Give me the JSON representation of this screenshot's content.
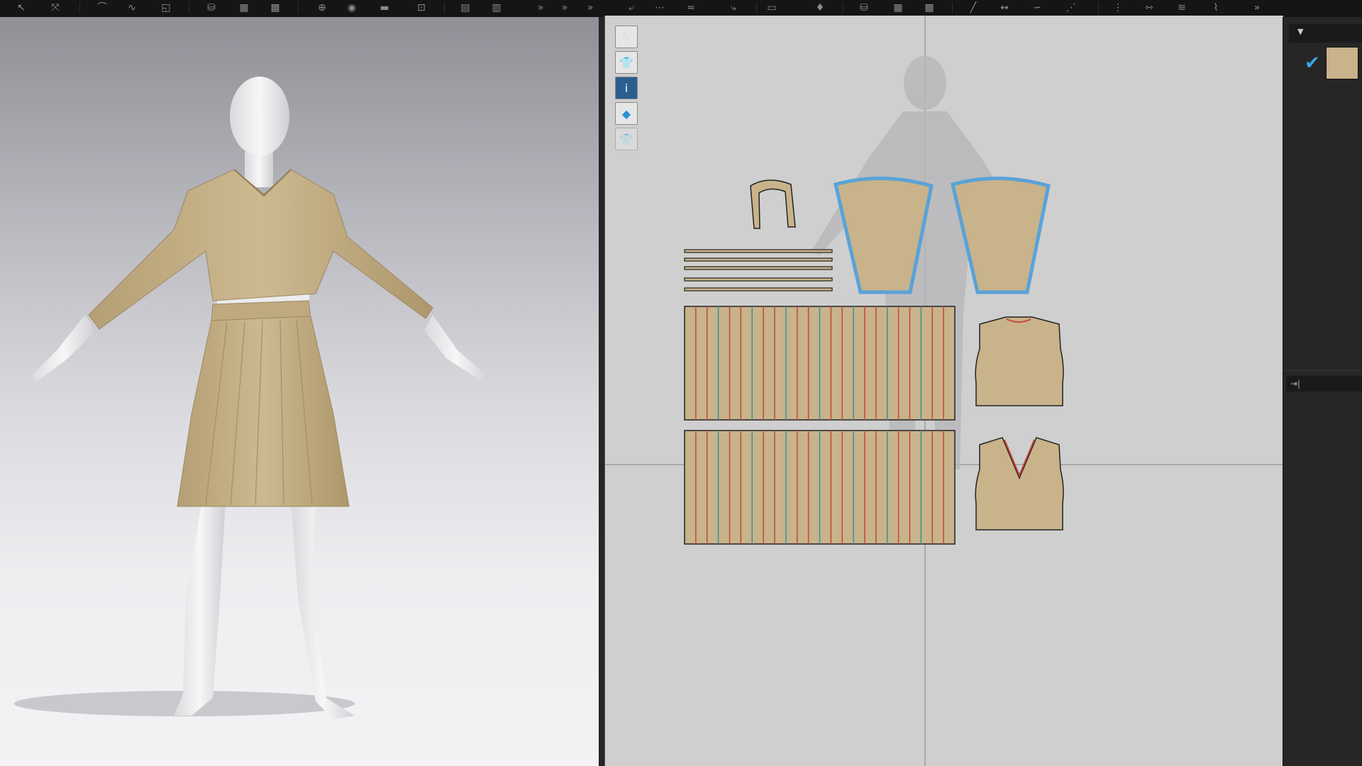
{
  "app": {
    "toolbar_icons": [
      "select-icon",
      "transform-icon",
      "curve-icon",
      "edit-curve-icon",
      "segment-icon",
      "fold-arrange-icon",
      "ruler-icon",
      "stitch-icon",
      "pin-icon",
      "button-icon",
      "buttonhole-icon",
      "topstitch-icon",
      "fabric-texture-icon",
      "graphic-icon",
      "move-icon",
      "measure-icon",
      "wave-icon",
      "flip-icon",
      "pleat-icon",
      "seam-icon",
      "sew-icon",
      "fold-icon",
      "avatar-icon",
      "line-icon",
      "dart-icon",
      "curve-point-icon",
      "segment-sew-icon",
      "tape-icon",
      "free-sew-icon",
      "elastic-icon"
    ]
  },
  "viewport2d": {
    "side_tools": [
      {
        "name": "pen-tool-icon",
        "glyph": "✎"
      },
      {
        "name": "garment-view-icon",
        "glyph": "👕"
      },
      {
        "name": "info-icon",
        "glyph": "i"
      },
      {
        "name": "texture-view-icon",
        "glyph": "◆"
      },
      {
        "name": "hidden-garment-icon",
        "glyph": "👕"
      }
    ]
  },
  "right_panel": {
    "dropdown_caret": "▼",
    "checked": "✔",
    "swatch_color": "#c8b38a",
    "collapse_glyph": "⇥|"
  },
  "colors": {
    "fabric": "#c8b38a",
    "seam_red": "#c8453a",
    "seam_teal": "#3b8fa0",
    "selected_outline": "#5aa2d8"
  }
}
